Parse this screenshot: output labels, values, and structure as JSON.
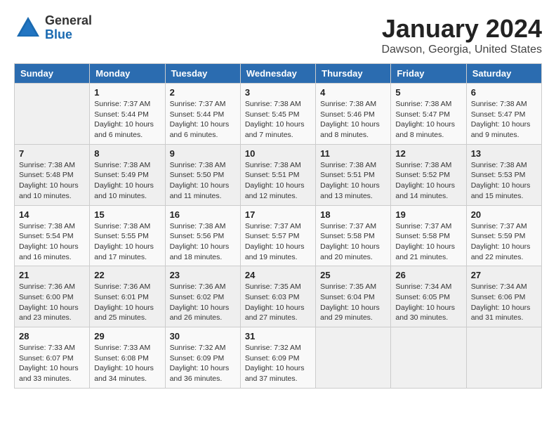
{
  "header": {
    "logo": {
      "general": "General",
      "blue": "Blue"
    },
    "title": "January 2024",
    "subtitle": "Dawson, Georgia, United States"
  },
  "calendar": {
    "weekdays": [
      "Sunday",
      "Monday",
      "Tuesday",
      "Wednesday",
      "Thursday",
      "Friday",
      "Saturday"
    ],
    "weeks": [
      [
        {
          "day": "",
          "info": ""
        },
        {
          "day": "1",
          "info": "Sunrise: 7:37 AM\nSunset: 5:44 PM\nDaylight: 10 hours\nand 6 minutes."
        },
        {
          "day": "2",
          "info": "Sunrise: 7:37 AM\nSunset: 5:44 PM\nDaylight: 10 hours\nand 6 minutes."
        },
        {
          "day": "3",
          "info": "Sunrise: 7:38 AM\nSunset: 5:45 PM\nDaylight: 10 hours\nand 7 minutes."
        },
        {
          "day": "4",
          "info": "Sunrise: 7:38 AM\nSunset: 5:46 PM\nDaylight: 10 hours\nand 8 minutes."
        },
        {
          "day": "5",
          "info": "Sunrise: 7:38 AM\nSunset: 5:47 PM\nDaylight: 10 hours\nand 8 minutes."
        },
        {
          "day": "6",
          "info": "Sunrise: 7:38 AM\nSunset: 5:47 PM\nDaylight: 10 hours\nand 9 minutes."
        }
      ],
      [
        {
          "day": "7",
          "info": "Sunrise: 7:38 AM\nSunset: 5:48 PM\nDaylight: 10 hours\nand 10 minutes."
        },
        {
          "day": "8",
          "info": "Sunrise: 7:38 AM\nSunset: 5:49 PM\nDaylight: 10 hours\nand 10 minutes."
        },
        {
          "day": "9",
          "info": "Sunrise: 7:38 AM\nSunset: 5:50 PM\nDaylight: 10 hours\nand 11 minutes."
        },
        {
          "day": "10",
          "info": "Sunrise: 7:38 AM\nSunset: 5:51 PM\nDaylight: 10 hours\nand 12 minutes."
        },
        {
          "day": "11",
          "info": "Sunrise: 7:38 AM\nSunset: 5:51 PM\nDaylight: 10 hours\nand 13 minutes."
        },
        {
          "day": "12",
          "info": "Sunrise: 7:38 AM\nSunset: 5:52 PM\nDaylight: 10 hours\nand 14 minutes."
        },
        {
          "day": "13",
          "info": "Sunrise: 7:38 AM\nSunset: 5:53 PM\nDaylight: 10 hours\nand 15 minutes."
        }
      ],
      [
        {
          "day": "14",
          "info": "Sunrise: 7:38 AM\nSunset: 5:54 PM\nDaylight: 10 hours\nand 16 minutes."
        },
        {
          "day": "15",
          "info": "Sunrise: 7:38 AM\nSunset: 5:55 PM\nDaylight: 10 hours\nand 17 minutes."
        },
        {
          "day": "16",
          "info": "Sunrise: 7:38 AM\nSunset: 5:56 PM\nDaylight: 10 hours\nand 18 minutes."
        },
        {
          "day": "17",
          "info": "Sunrise: 7:37 AM\nSunset: 5:57 PM\nDaylight: 10 hours\nand 19 minutes."
        },
        {
          "day": "18",
          "info": "Sunrise: 7:37 AM\nSunset: 5:58 PM\nDaylight: 10 hours\nand 20 minutes."
        },
        {
          "day": "19",
          "info": "Sunrise: 7:37 AM\nSunset: 5:58 PM\nDaylight: 10 hours\nand 21 minutes."
        },
        {
          "day": "20",
          "info": "Sunrise: 7:37 AM\nSunset: 5:59 PM\nDaylight: 10 hours\nand 22 minutes."
        }
      ],
      [
        {
          "day": "21",
          "info": "Sunrise: 7:36 AM\nSunset: 6:00 PM\nDaylight: 10 hours\nand 23 minutes."
        },
        {
          "day": "22",
          "info": "Sunrise: 7:36 AM\nSunset: 6:01 PM\nDaylight: 10 hours\nand 25 minutes."
        },
        {
          "day": "23",
          "info": "Sunrise: 7:36 AM\nSunset: 6:02 PM\nDaylight: 10 hours\nand 26 minutes."
        },
        {
          "day": "24",
          "info": "Sunrise: 7:35 AM\nSunset: 6:03 PM\nDaylight: 10 hours\nand 27 minutes."
        },
        {
          "day": "25",
          "info": "Sunrise: 7:35 AM\nSunset: 6:04 PM\nDaylight: 10 hours\nand 29 minutes."
        },
        {
          "day": "26",
          "info": "Sunrise: 7:34 AM\nSunset: 6:05 PM\nDaylight: 10 hours\nand 30 minutes."
        },
        {
          "day": "27",
          "info": "Sunrise: 7:34 AM\nSunset: 6:06 PM\nDaylight: 10 hours\nand 31 minutes."
        }
      ],
      [
        {
          "day": "28",
          "info": "Sunrise: 7:33 AM\nSunset: 6:07 PM\nDaylight: 10 hours\nand 33 minutes."
        },
        {
          "day": "29",
          "info": "Sunrise: 7:33 AM\nSunset: 6:08 PM\nDaylight: 10 hours\nand 34 minutes."
        },
        {
          "day": "30",
          "info": "Sunrise: 7:32 AM\nSunset: 6:09 PM\nDaylight: 10 hours\nand 36 minutes."
        },
        {
          "day": "31",
          "info": "Sunrise: 7:32 AM\nSunset: 6:09 PM\nDaylight: 10 hours\nand 37 minutes."
        },
        {
          "day": "",
          "info": ""
        },
        {
          "day": "",
          "info": ""
        },
        {
          "day": "",
          "info": ""
        }
      ]
    ]
  }
}
